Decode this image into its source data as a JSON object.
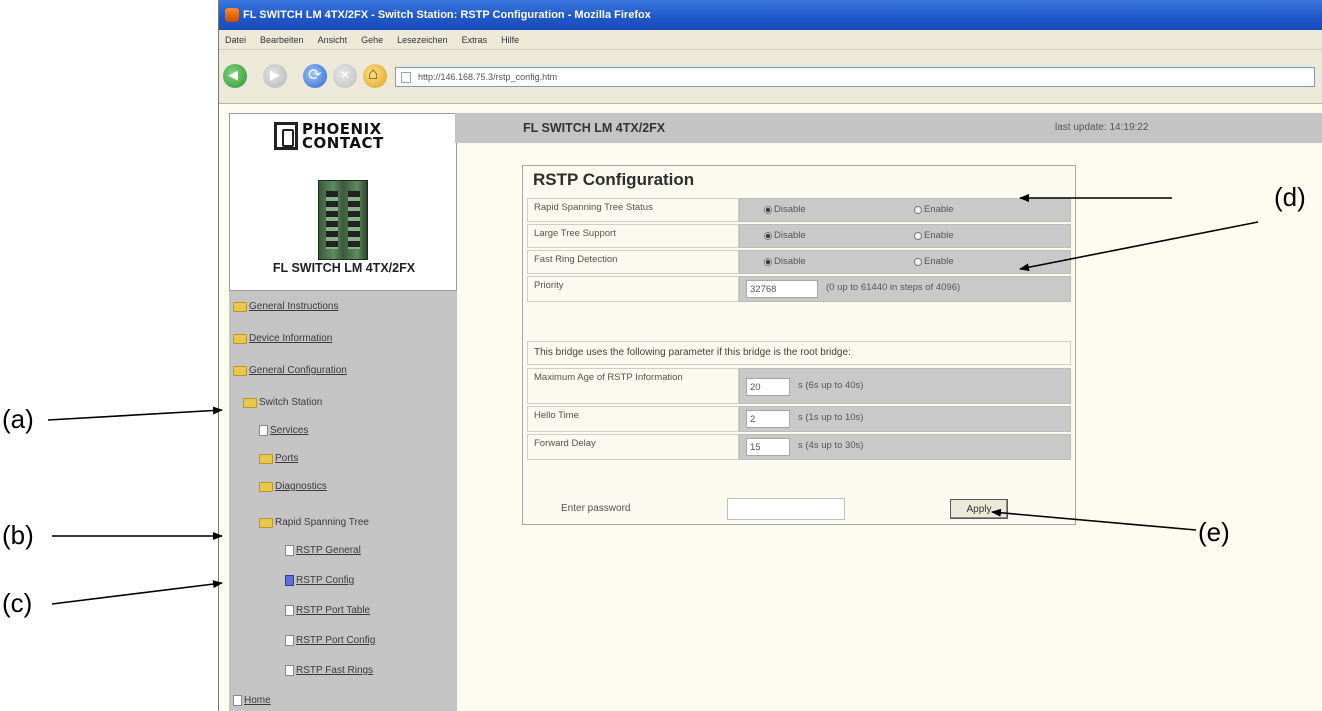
{
  "browser": {
    "title": "FL SWITCH LM 4TX/2FX - Switch Station: RSTP Configuration - Mozilla Firefox",
    "menu": [
      "Datei",
      "Bearbeiten",
      "Ansicht",
      "Gehe",
      "Lesezeichen",
      "Extras",
      "Hilfe"
    ],
    "url": "http://146.168.75.3/rstp_config.htm"
  },
  "sidebar": {
    "logo_line1": "PHOENIX",
    "logo_line2": "CONTACT",
    "device_name": "FL SWITCH LM 4TX/2FX",
    "items": [
      {
        "label": "General Instructions",
        "icon": "folder-icon"
      },
      {
        "label": "Device Information",
        "icon": "folder-icon"
      },
      {
        "label": "General Configuration",
        "icon": "folder-icon"
      },
      {
        "label": "Switch Station",
        "icon": "folder-open-icon"
      },
      {
        "label": "Services",
        "icon": "document-icon"
      },
      {
        "label": "Ports",
        "icon": "folder-icon"
      },
      {
        "label": "Diagnostics",
        "icon": "folder-icon"
      },
      {
        "label": "Rapid Spanning Tree",
        "icon": "folder-open-icon"
      },
      {
        "label": "RSTP General",
        "icon": "document-icon"
      },
      {
        "label": "RSTP Config",
        "icon": "document-active-icon"
      },
      {
        "label": "RSTP Port Table",
        "icon": "document-icon"
      },
      {
        "label": "RSTP Port Config",
        "icon": "document-icon"
      },
      {
        "label": "RSTP Fast Rings",
        "icon": "document-icon"
      },
      {
        "label": "Home",
        "icon": "document-icon"
      }
    ]
  },
  "header": {
    "product": "FL SWITCH LM 4TX/2FX",
    "last_update": "last update: 14:19:22"
  },
  "panel": {
    "title": "RSTP Configuration",
    "disable_label": "Disable",
    "enable_label": "Enable",
    "rows": [
      {
        "label": "Rapid Spanning Tree Status",
        "selected": "Disable"
      },
      {
        "label": "Large Tree Support",
        "selected": "Disable"
      },
      {
        "label": "Fast Ring Detection",
        "selected": "Disable"
      }
    ],
    "priority": {
      "label": "Priority",
      "value": "32768",
      "hint": "(0 up to 61440 in steps of 4096)"
    },
    "root_sentence": "This bridge uses the following parameter if this bridge is the root bridge:",
    "timing": [
      {
        "label": "Maximum Age of RSTP Information",
        "value": "20",
        "hint": "s (6s up to 40s)"
      },
      {
        "label": "Hello Time",
        "value": "2",
        "hint": "s (1s up to 10s)"
      },
      {
        "label": "Forward Delay",
        "value": "15",
        "hint": "s (4s up to 30s)"
      }
    ],
    "password_label": "Enter password",
    "apply_label": "Apply"
  },
  "annotations": {
    "a": "(a)",
    "b": "(b)",
    "c": "(c)",
    "d": "(d)",
    "e": "(e)"
  }
}
